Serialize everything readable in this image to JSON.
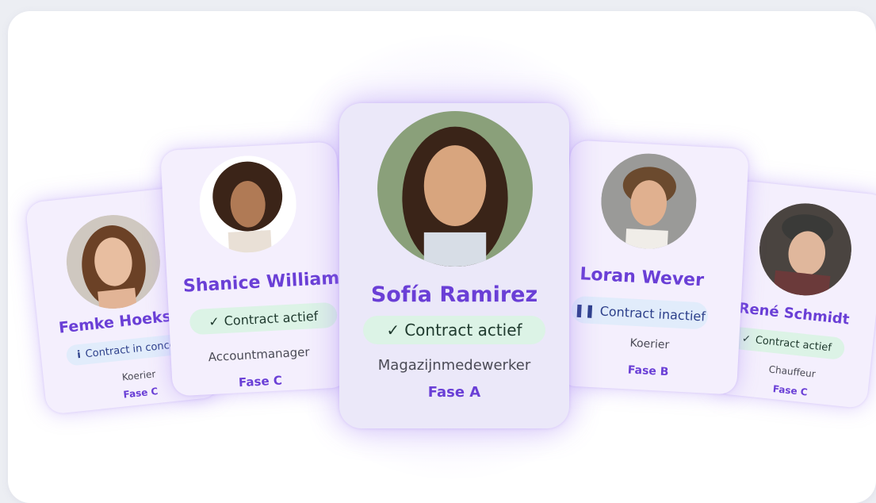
{
  "cards": [
    {
      "name": "Femke Hoekstr",
      "status": "Contract in concep",
      "status_icon": "info-icon",
      "role": "Koerier",
      "phase": "Fase C"
    },
    {
      "name": "Shanice Williams",
      "status": "Contract actief",
      "status_icon": "check-icon",
      "role": "Accountmanager",
      "phase": "Fase C"
    },
    {
      "name": "Sofía Ramirez",
      "status": "Contract actief",
      "status_icon": "check-icon",
      "role": "Magazijnmedewerker",
      "phase": "Fase A"
    },
    {
      "name": "Loran Wever",
      "status": "Contract inactief",
      "status_icon": "pause-icon",
      "role": "Koerier",
      "phase": "Fase B"
    },
    {
      "name": "René Schmidt",
      "status": "Contract actief",
      "status_icon": "check-icon",
      "role": "Chauffeur",
      "phase": "Fase C"
    }
  ],
  "icons": {
    "check": "✓",
    "info": "i",
    "pause": "❚❚"
  },
  "colors": {
    "accent": "#6a3fd6",
    "active_bg": "#dcf3e6",
    "inactive_bg": "#e1ecfb",
    "card_bg": "#f4effd"
  }
}
